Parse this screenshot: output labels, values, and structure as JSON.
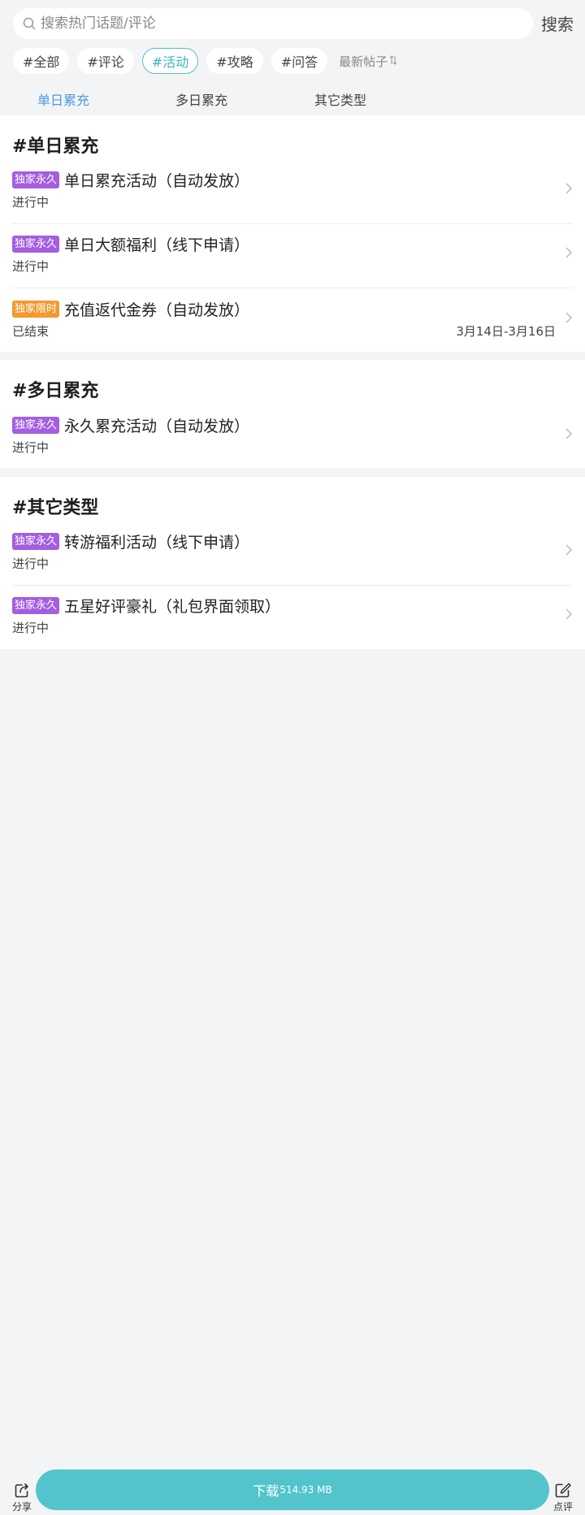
{
  "search": {
    "placeholder": "搜索热门话题/评论",
    "button_label": "搜索"
  },
  "chips": [
    {
      "label": "#全部",
      "active": false
    },
    {
      "label": "#评论",
      "active": false
    },
    {
      "label": "#活动",
      "active": true
    },
    {
      "label": "#攻略",
      "active": false
    },
    {
      "label": "#问答",
      "active": false
    }
  ],
  "sort": {
    "label": "最新帖子",
    "icon": "sort-arrows-icon"
  },
  "tabs": [
    {
      "label": "单日累充",
      "active": true
    },
    {
      "label": "多日累充",
      "active": false
    },
    {
      "label": "其它类型",
      "active": false
    }
  ],
  "sections": [
    {
      "title": "#单日累充",
      "items": [
        {
          "badge": "独家永久",
          "badge_color": "#a45ee0",
          "title": "单日累充活动（自动发放）",
          "status": "进行中",
          "date": ""
        },
        {
          "badge": "独家永久",
          "badge_color": "#a45ee0",
          "title": "单日大额福利（线下申请）",
          "status": "进行中",
          "date": ""
        },
        {
          "badge": "独家限时",
          "badge_color": "#f39a2c",
          "title": "充值返代金券（自动发放）",
          "status": "已结束",
          "date": "3月14日-3月16日"
        }
      ]
    },
    {
      "title": "#多日累充",
      "items": [
        {
          "badge": "独家永久",
          "badge_color": "#a45ee0",
          "title": "永久累充活动（自动发放）",
          "status": "进行中",
          "date": ""
        }
      ]
    },
    {
      "title": "#其它类型",
      "items": [
        {
          "badge": "独家永久",
          "badge_color": "#a45ee0",
          "title": "转游福利活动（线下申请）",
          "status": "进行中",
          "date": ""
        },
        {
          "badge": "独家永久",
          "badge_color": "#a45ee0",
          "title": "五星好评豪礼（礼包界面领取）",
          "status": "进行中",
          "date": ""
        }
      ]
    }
  ],
  "bottom": {
    "share_label": "分享",
    "review_label": "点评",
    "download_label": "下载",
    "download_size": "514.93 MB"
  },
  "colors": {
    "accent": "#53c4cc",
    "tab_active": "#4a9be6",
    "badge_permanent": "#a45ee0",
    "badge_limited": "#f39a2c"
  }
}
